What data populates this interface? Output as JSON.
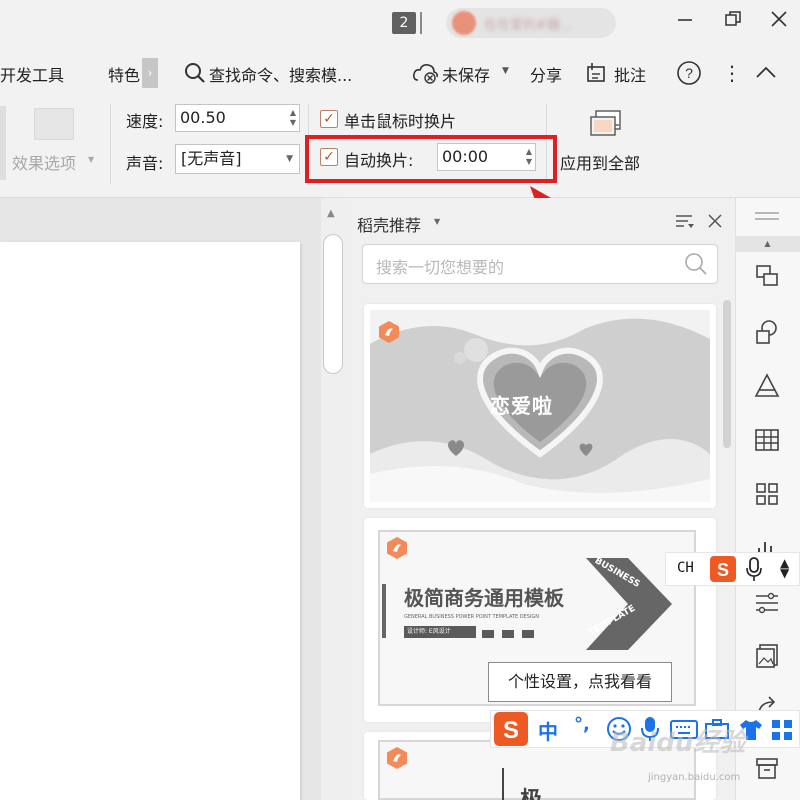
{
  "titlebar": {
    "window_count": "2",
    "user_name": "在在爱的#糖..."
  },
  "menu": {
    "dev_tools": "开发工具",
    "special": "特色",
    "search_command": "查找命令、搜索模...",
    "unsaved": "未保存",
    "share": "分享",
    "annotate": "批注"
  },
  "ribbon": {
    "effect_options": "效果选项",
    "speed_label": "速度:",
    "speed_value": "00.50",
    "sound_label": "声音:",
    "sound_value": "[无声音]",
    "click_advance_label": "单击鼠标时换片",
    "auto_advance_label": "自动换片:",
    "auto_advance_value": "00:00",
    "apply_all_label": "应用到全部"
  },
  "panel": {
    "title": "稻壳推荐",
    "search_placeholder": "搜索一切您想要的",
    "template1_title": "恋爱啦",
    "template2_title": "极简商务通用模板",
    "template2_subtitle": "GENERAL BUSINESS POWER POINT TEMPLATE DESIGN",
    "template2_designer": "设计师: E风设计",
    "template2_banner_top": "BUSINESS",
    "template2_banner_bottom": "TEMPLATE",
    "template3_title": "极"
  },
  "ime": {
    "top_label": "CH",
    "zh_label": "中",
    "punct_label": "°,",
    "tooltip": "个性设置，点我看看"
  },
  "watermark": {
    "brand": "Baidu经验",
    "url": "jingyan.baidu.com"
  },
  "colors": {
    "highlight_red": "#e02020",
    "checkbox_orange": "#c0522e",
    "docer_orange": "#f28a5a",
    "sogou_orange": "#ee5a24",
    "ime_blue": "#1a73e8"
  }
}
